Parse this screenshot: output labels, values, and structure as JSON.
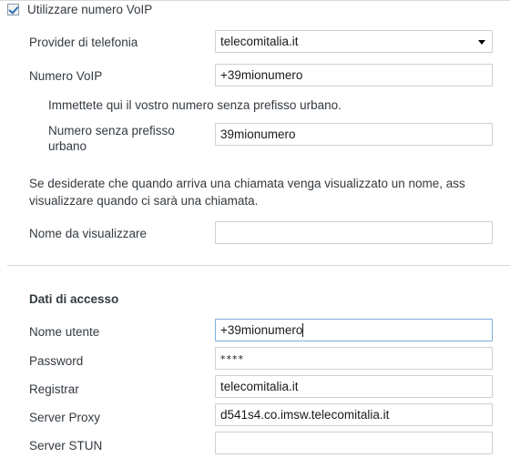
{
  "section_voip": {
    "checkbox": {
      "label": "Utilizzare numero VoIP",
      "checked": true
    },
    "provider": {
      "label": "Provider di telefonia",
      "value": "telecomitalia.it",
      "options": [
        "telecomitalia.it"
      ]
    },
    "numero_voip": {
      "label": "Numero VoIP",
      "value": "+39mionumero",
      "placeholder": ""
    },
    "hint_numero": "Immettete qui il vostro numero senza prefisso urbano.",
    "numero_senza_prefisso": {
      "label": "Numero senza prefisso urbano",
      "value": "39mionumero",
      "placeholder": ""
    },
    "hint_nome_line1": "Se desiderate che quando arriva una chiamata venga visualizzato un nome, ass",
    "hint_nome_line2": "visualizzare quando ci sarà una chiamata.",
    "nome_visualizzare": {
      "label": "Nome da visualizzare",
      "value": "",
      "placeholder": ""
    }
  },
  "section_accesso": {
    "heading": "Dati di accesso",
    "nome_utente": {
      "label": "Nome utente",
      "value": "+39mionumero",
      "placeholder": "",
      "focused": true
    },
    "password": {
      "label": "Password",
      "value": "****",
      "placeholder": ""
    },
    "registrar": {
      "label": "Registrar",
      "value": "telecomitalia.it",
      "placeholder": ""
    },
    "server_proxy": {
      "label": "Server Proxy",
      "value": "d541s4.co.imsw.telecomitalia.it",
      "placeholder": ""
    },
    "server_stun": {
      "label": "Server STUN",
      "value": "",
      "placeholder": ""
    }
  },
  "icons": {
    "dropdown_arrow": "chevron-down-icon",
    "checkmark": "check-icon"
  },
  "colors": {
    "text": "#333a40",
    "field_border": "#cfcfcf",
    "focus_border": "#7aaddc",
    "checkmark": "#2f6fb5",
    "divider": "#d7d7d7"
  }
}
